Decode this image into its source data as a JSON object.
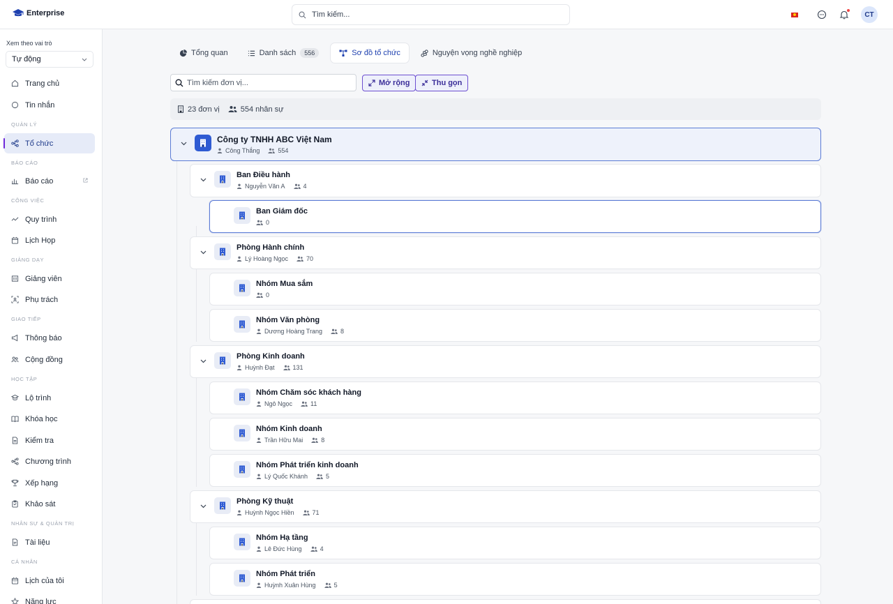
{
  "app": {
    "brand": "Enterprise"
  },
  "header": {
    "search_placeholder": "Tìm kiếm...",
    "avatar": "CT",
    "language_flag": "vn-flag-icon"
  },
  "sidebar": {
    "role_label": "Xem theo vai trò",
    "role_value": "Tự động",
    "items": [
      {
        "label": "Trang chủ",
        "icon": "home-icon"
      },
      {
        "label": "Tin nhắn",
        "icon": "message-icon"
      },
      {
        "section": "QUẢN LÝ"
      },
      {
        "label": "Tổ chức",
        "icon": "org-icon",
        "active": true
      },
      {
        "section": "BÁO CÁO"
      },
      {
        "label": "Báo cáo",
        "icon": "chart-icon",
        "external": true
      },
      {
        "section": "CÔNG VIỆC"
      },
      {
        "label": "Quy trình",
        "icon": "workflow-icon"
      },
      {
        "label": "Lịch Họp",
        "icon": "calendar-icon"
      },
      {
        "section": "GIẢNG DẠY"
      },
      {
        "label": "Giảng viên",
        "icon": "teacher-icon"
      },
      {
        "label": "Phụ trách",
        "icon": "assign-icon"
      },
      {
        "section": "GIAO TIẾP"
      },
      {
        "label": "Thông báo",
        "icon": "megaphone-icon"
      },
      {
        "label": "Cộng đồng",
        "icon": "community-icon"
      },
      {
        "section": "HỌC TẬP"
      },
      {
        "label": "Lộ trình",
        "icon": "graduation-icon"
      },
      {
        "label": "Khóa học",
        "icon": "book-icon"
      },
      {
        "label": "Kiểm tra",
        "icon": "test-icon"
      },
      {
        "label": "Chương trình",
        "icon": "program-icon"
      },
      {
        "label": "Xếp hạng",
        "icon": "trophy-icon"
      },
      {
        "label": "Khảo sát",
        "icon": "survey-icon"
      },
      {
        "section": "NHÂN SỰ & QUẢN TRỊ"
      },
      {
        "label": "Tài liệu",
        "icon": "document-icon"
      },
      {
        "section": "CÁ NHÂN"
      },
      {
        "label": "Lịch của tôi",
        "icon": "my-calendar-icon"
      },
      {
        "label": "Năng lực",
        "icon": "star-icon"
      }
    ]
  },
  "tabs": [
    {
      "label": "Tổng quan",
      "icon": "pie-icon"
    },
    {
      "label": "Danh sách",
      "icon": "list-icon",
      "badge": "556"
    },
    {
      "label": "Sơ đồ tổ chức",
      "icon": "orgchart-icon",
      "active": true
    },
    {
      "label": "Nguyện vọng nghề nghiệp",
      "icon": "career-icon"
    }
  ],
  "toolbar": {
    "unit_search_placeholder": "Tìm kiếm đơn vị...",
    "expand_label": "Mở rộng",
    "collapse_label": "Thu gọn"
  },
  "stats": {
    "units": "23 đơn vị",
    "people": "554 nhân sự"
  },
  "tree": {
    "root": {
      "name": "Công ty TNHH ABC Việt Nam",
      "manager": "Công Thắng",
      "count": "554"
    },
    "departments": [
      {
        "name": "Ban Điều hành",
        "manager": "Nguyễn Văn A",
        "count": "4",
        "teams": [
          {
            "name": "Ban Giám đốc",
            "manager": "",
            "count": "0",
            "selected": true
          }
        ]
      },
      {
        "name": "Phòng Hành chính",
        "manager": "Lý Hoàng Ngọc",
        "count": "70",
        "teams": [
          {
            "name": "Nhóm Mua sắm",
            "manager": "",
            "count": "0"
          },
          {
            "name": "Nhóm Văn phòng",
            "manager": "Dương Hoàng Trang",
            "count": "8"
          }
        ]
      },
      {
        "name": "Phòng Kinh doanh",
        "manager": "Huỳnh Đạt",
        "count": "131",
        "teams": [
          {
            "name": "Nhóm Chăm sóc khách hàng",
            "manager": "Ngô Ngọc",
            "count": "11"
          },
          {
            "name": "Nhóm Kinh doanh",
            "manager": "Trần Hữu Mai",
            "count": "8"
          },
          {
            "name": "Nhóm Phát triển kinh doanh",
            "manager": "Lý Quốc Khánh",
            "count": "5"
          }
        ]
      },
      {
        "name": "Phòng Kỹ thuật",
        "manager": "Huỳnh Ngọc Hiền",
        "count": "71",
        "teams": [
          {
            "name": "Nhóm Hạ tầng",
            "manager": "Lê Đức Hùng",
            "count": "4"
          },
          {
            "name": "Nhóm Phát triển",
            "manager": "Huỳnh Xuân Hùng",
            "count": "5"
          }
        ]
      }
    ]
  }
}
